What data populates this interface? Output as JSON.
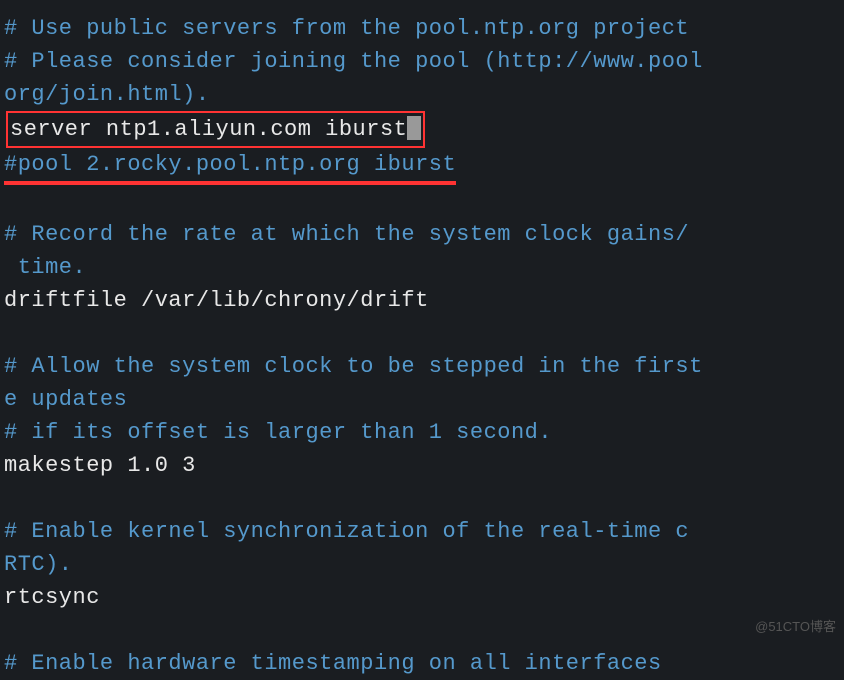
{
  "lines": {
    "l1": "# Use public servers from the pool.ntp.org project",
    "l2": "# Please consider joining the pool (http://www.pool",
    "l3": "org/join.html).",
    "l4_boxed": "server ntp1.aliyun.com iburst",
    "l5_pre": "#pool 2.rocky.pool.ntp.org iburst",
    "l6": "",
    "l7": "# Record the rate at which the system clock gains/",
    "l8": " time.",
    "l9": "driftfile /var/lib/chrony/drift",
    "l10": "",
    "l11": "# Allow the system clock to be stepped in the first",
    "l12": "e updates",
    "l13": "# if its offset is larger than 1 second.",
    "l14": "makestep 1.0 3",
    "l15": "",
    "l16": "# Enable kernel synchronization of the real-time c",
    "l17": "RTC).",
    "l18": "rtcsync",
    "l19": "",
    "l20": "# Enable hardware timestamping on all interfaces "
  },
  "watermark": "@51CTO博客"
}
